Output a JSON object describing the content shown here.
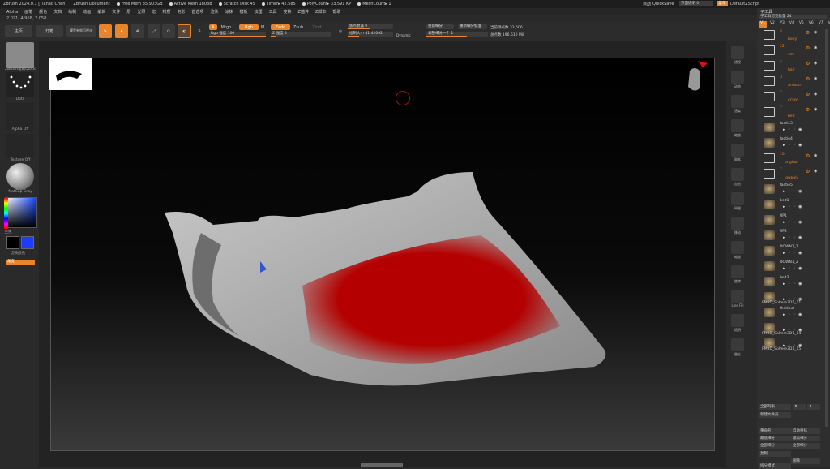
{
  "titlebar": {
    "app": "ZBrush 2024.0.1 [Tianao Chen]",
    "doc": "ZBrush Document",
    "free_mem": "Free Mem 35.903GB",
    "active_mem": "Active Mem 1803B",
    "scratch": "Scratch Disk 45",
    "timer": "Timer▸ 42.585",
    "poly": "PolyCount▸ 33.591 KP",
    "mesh": "MeshCount▸ 1",
    "quicksave": "QuickSave",
    "transparency": "界面透明 0",
    "menu_btn": "菜单",
    "script": "DefaultZScript"
  },
  "menu": [
    "Alpha",
    "画笔",
    "颜色",
    "文档",
    "绘制",
    "动画",
    "编辑",
    "文件",
    "层",
    "光照",
    "宏",
    "材质",
    "电影",
    "首选项",
    "渲染",
    "涂抹",
    "模板",
    "纹理",
    "工具",
    "变换",
    "Z插件",
    "Z脚本",
    "帮助"
  ],
  "coords": "2.071, 4.968, 2.058",
  "toolbar": {
    "main": "主页",
    "light": "灯箱",
    "quick": "模型有效可视派",
    "a": "A",
    "mrgb": "Mrgb",
    "rgb": "Rgb",
    "m": "M",
    "zadd": "Zadd",
    "zsub": "Zsub",
    "zcut": "Zcut",
    "rgb_intensity": "Rgb 强度 100",
    "z_intensity": "Z 强度 4",
    "focal": "焦点衰减 0",
    "draw_size": "绘制大小 41.42092",
    "dynamic": "Dynamic",
    "active_pts": "当前顶点数 33,606",
    "total_pts": "总点数 196.610 Mil",
    "subdiv": "重新细分",
    "subdiv_adj": "调整细分一个 1",
    "adaptive": "重新细分标准"
  },
  "leftpanel": {
    "tool_label": "ZBrush笔刷Quick",
    "dots_label": "Dots",
    "alpha_label": "Alpha Off",
    "texture_label": "Texture Off",
    "material_label": "MatCap Gray",
    "color_label": "主色",
    "switch_label": "切换颜色",
    "fill_label": "渐变"
  },
  "rightstrip": [
    "透视",
    "动态",
    "渲染",
    "缩放",
    "副本",
    "自由",
    "网格",
    "移动",
    "缩放",
    "旋转",
    "Line Fill",
    "透明",
    "独立"
  ],
  "subtool": {
    "title": "子工具",
    "header": "子工具可见数量 24",
    "tabs": [
      "V1",
      "V2",
      "V3",
      "V4",
      "V5",
      "V6",
      "V7",
      "V8"
    ],
    "items": [
      {
        "name": "body",
        "type": "folder",
        "count": "4"
      },
      {
        "name": "cm",
        "type": "folder",
        "count": "22"
      },
      {
        "name": "hair",
        "type": "folder",
        "count": "4"
      },
      {
        "name": "armour",
        "type": "folder",
        "count": "3"
      },
      {
        "name": "COPY",
        "type": "folder",
        "count": "2"
      },
      {
        "name": "belt",
        "type": "folder",
        "count": "7"
      },
      {
        "name": "taotie3",
        "type": "mesh"
      },
      {
        "name": "taotie4",
        "type": "mesh"
      },
      {
        "name": "original",
        "type": "folder",
        "count": "10"
      },
      {
        "name": "lowpoly",
        "type": "folder",
        "count": "7"
      },
      {
        "name": "taotie5",
        "type": "mesh"
      },
      {
        "name": "belt1",
        "type": "mesh"
      },
      {
        "name": "UP1",
        "type": "mesh"
      },
      {
        "name": "UP2",
        "type": "mesh"
      },
      {
        "name": "DOWN1_1",
        "type": "mesh"
      },
      {
        "name": "DOWN1_2",
        "type": "mesh"
      },
      {
        "name": "belt3",
        "type": "mesh"
      },
      {
        "name": "PM3D_Sphere3D1_11",
        "type": "mesh"
      },
      {
        "name": "thridout",
        "type": "mesh"
      },
      {
        "name": "PM3D_Sphere3D1_14",
        "type": "mesh"
      },
      {
        "name": "PM3D_Sphere3D1_15",
        "type": "mesh"
      }
    ]
  },
  "rp_buttons": {
    "list_all": "全部列表",
    "new_folder": "新建文件夹",
    "rename": "重命名",
    "auto_reorder": "自动重排",
    "all_low": "最低细分",
    "all_high": "最高细分",
    "dup": "复制",
    "del": "删除",
    "all_tog": "全部细分",
    "all_low2": "全部细分",
    "copy": "复制",
    "del2": "删除",
    "split": "拆分模式"
  },
  "colors": {
    "accent": "#e8852a",
    "red_mask": "#b40000"
  }
}
